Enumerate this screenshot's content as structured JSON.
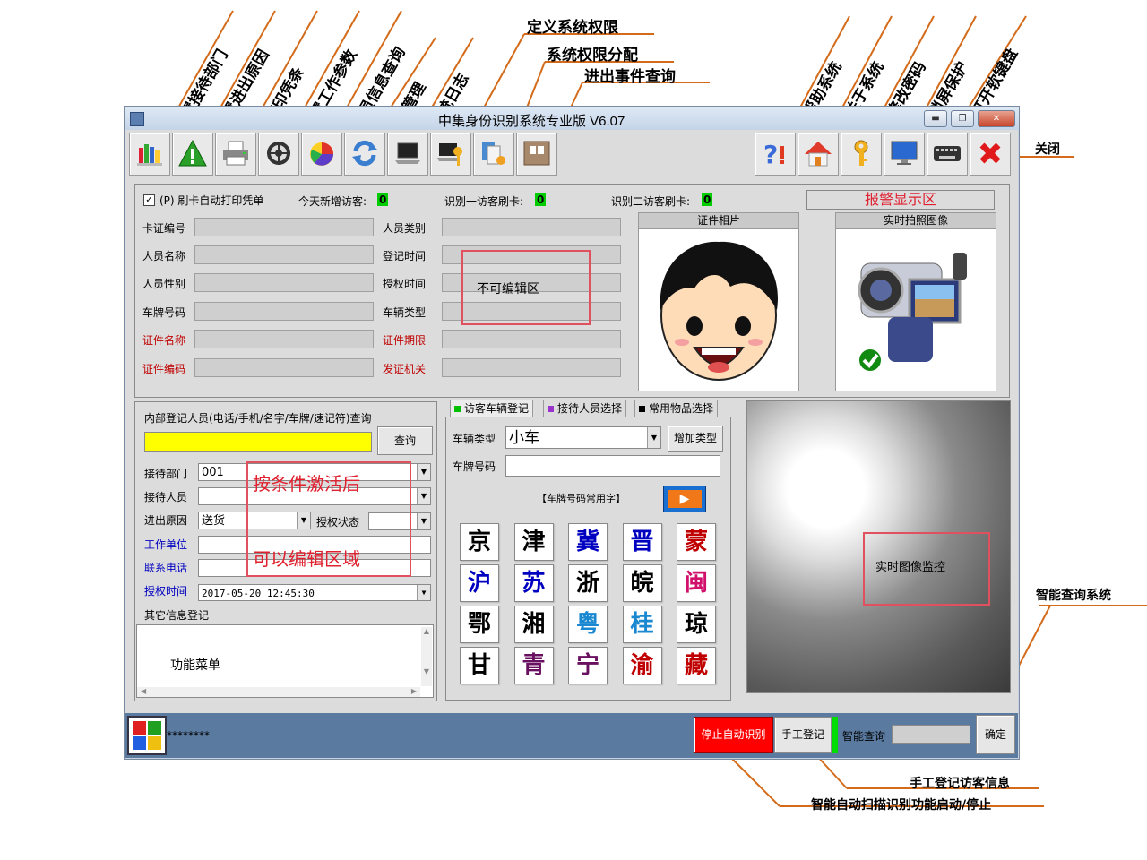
{
  "annotations": {
    "top_rotated": [
      "设置接待部门",
      "设置进出原因",
      "打印凭条",
      "设置工作参数",
      "人员信息查询",
      "短信管理",
      "系统日志"
    ],
    "top_rotated_right": [
      "帮助系统",
      "关于系统",
      "修改密码",
      "锁屏保护",
      "打开软键盘"
    ],
    "define_rights": "定义系统权限",
    "assign_rights": "系统权限分配",
    "event_query": "进出事件查询",
    "close": "关闭",
    "smart_query_system": "智能查询系统",
    "manual_register_info": "手工登记访客信息",
    "auto_scan_toggle": "智能自动扫描识别功能启动/停止",
    "function_menu": "功能菜单"
  },
  "window": {
    "title": "中集身份识别系统专业版 V6.07",
    "min": "▬",
    "max": "❐",
    "close": "✕"
  },
  "info": {
    "auto_print_label": "(P) 刷卡自动打印凭单",
    "today_new_label": "今天新增访客:",
    "today_new_value": "0",
    "id1_label": "识别一访客刷卡:",
    "id1_value": "0",
    "id2_label": "识别二访客刷卡:",
    "id2_value": "0",
    "alarm_area": "报警显示区",
    "left_fields": [
      "卡证编号",
      "人员名称",
      "人员性别",
      "车牌号码",
      "证件名称",
      "证件编码"
    ],
    "right_fields": [
      "人员类别",
      "登记时间",
      "授权时间",
      "车辆类型",
      "证件期限",
      "发证机关"
    ],
    "noneditable_note": "不可编辑区",
    "id_photo": "证件相片",
    "live_photo": "实时拍照图像"
  },
  "form": {
    "search_label": "内部登记人员(电话/手机/名字/车牌/速记符)查询",
    "search_button": "查询",
    "dept_label": "接待部门",
    "dept_value": "001",
    "staff_label": "接待人员",
    "reason_label": "进出原因",
    "reason_value": "送货",
    "auth_status_label": "授权状态",
    "work_unit_label": "工作单位",
    "phone_label": "联系电话",
    "auth_time_label": "授权时间",
    "auth_time_value": "2017-05-20  12:45:30",
    "other_info_label": "其它信息登记",
    "edit_note_1": "按条件激活后",
    "edit_note_2": "可以编辑区域"
  },
  "vehicle": {
    "tabs": [
      "访客车辆登记",
      "接待人员选择",
      "常用物品选择"
    ],
    "tab_colors": [
      "#00c000",
      "#9933cc",
      "#000000"
    ],
    "type_label": "车辆类型",
    "type_value": "小车",
    "add_type_button": "增加类型",
    "plate_label": "车牌号码",
    "common_chars_label": "【车牌号码常用字】",
    "play_icon": "▶",
    "keys": [
      {
        "c": "京",
        "color": "#000000"
      },
      {
        "c": "津",
        "color": "#000000"
      },
      {
        "c": "冀",
        "color": "#0000c0"
      },
      {
        "c": "晋",
        "color": "#0000c0"
      },
      {
        "c": "蒙",
        "color": "#c00000"
      },
      {
        "c": "沪",
        "color": "#0000c0"
      },
      {
        "c": "苏",
        "color": "#0000c0"
      },
      {
        "c": "浙",
        "color": "#000000"
      },
      {
        "c": "皖",
        "color": "#000000"
      },
      {
        "c": "闽",
        "color": "#d0106a"
      },
      {
        "c": "鄂",
        "color": "#000000"
      },
      {
        "c": "湘",
        "color": "#000000"
      },
      {
        "c": "粤",
        "color": "#1a88d0"
      },
      {
        "c": "桂",
        "color": "#1a88d0"
      },
      {
        "c": "琼",
        "color": "#000000"
      },
      {
        "c": "甘",
        "color": "#000000"
      },
      {
        "c": "青",
        "color": "#6a1060"
      },
      {
        "c": "宁",
        "color": "#6a1060"
      },
      {
        "c": "渝",
        "color": "#c00000"
      },
      {
        "c": "藏",
        "color": "#c00000"
      }
    ]
  },
  "monitor": {
    "label": "实时图像监控"
  },
  "statusbar": {
    "stars": "********",
    "stop_auto_button": "停止自动识别",
    "manual_register_button": "手工登记",
    "smart_query_label": "智能查询",
    "confirm_button": "确定"
  },
  "colors": {
    "accent_orange": "#d46b1a",
    "stop_button": "#ff0000",
    "search_field": "#ffff00",
    "status_bar": "#5a7aa0"
  }
}
